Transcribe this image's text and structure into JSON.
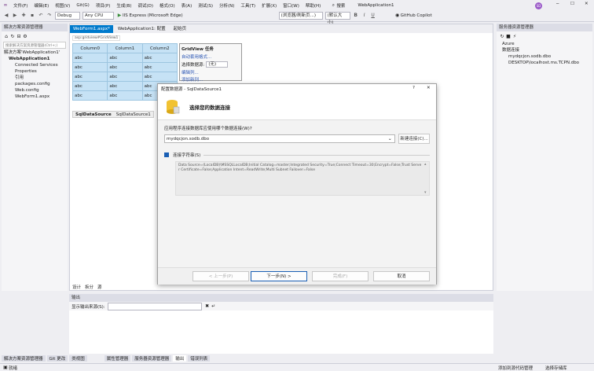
{
  "menu": {
    "items": [
      "文件(F)",
      "编辑(E)",
      "视图(V)",
      "Git(G)",
      "项目(P)",
      "生成(B)",
      "调试(D)",
      "格式(O)",
      "表(A)",
      "测试(S)",
      "分析(N)",
      "工具(T)",
      "扩展(X)",
      "窗口(W)",
      "帮助(H)"
    ],
    "search": "搜索",
    "solution_name": "WebApplication1",
    "avatar": "SD"
  },
  "toolbar": {
    "config": "Debug",
    "platform": "Any CPU",
    "run": "IIS Express (Microsoft Edge)",
    "browser_combo": "(浏览器/刷新页...)",
    "font_size": "(默认大小)",
    "copilot": "GitHub Copilot"
  },
  "solution_explorer": {
    "title": "解决方案资源管理器",
    "search_placeholder": "搜索解决方案资源管理器(Ctrl+;)",
    "items": [
      {
        "label": "解决方案'WebApplication1'",
        "indent": 0
      },
      {
        "label": "WebApplication1",
        "indent": 1
      },
      {
        "label": "Connected Services",
        "indent": 2
      },
      {
        "label": "Properties",
        "indent": 2
      },
      {
        "label": "引用",
        "indent": 2
      },
      {
        "label": "packages.config",
        "indent": 2
      },
      {
        "label": "Web.config",
        "indent": 2
      },
      {
        "label": "WebForm1.aspx",
        "indent": 2
      }
    ]
  },
  "editor": {
    "tabs": [
      "WebForm1.aspx*",
      "WebApplication1: 配置",
      "起始页"
    ],
    "path": "asp:gridview#GridView1",
    "columns": [
      "Column0",
      "Column1",
      "Column2"
    ],
    "rows": [
      [
        "abc",
        "abc",
        "abc"
      ],
      [
        "abc",
        "abc",
        "abc"
      ],
      [
        "abc",
        "abc",
        "abc"
      ],
      [
        "abc",
        "abc",
        "abc"
      ],
      [
        "abc",
        "abc",
        "abc"
      ]
    ],
    "datasource_tabs": [
      "SqlDataSource",
      "SqlDataSource1"
    ],
    "bottom_tabs": [
      "设计",
      "拆分",
      "源"
    ]
  },
  "gridview_tasks": {
    "title": "GridView 任务",
    "autoformat": "自动套用格式...",
    "choose_ds_label": "选择数据源:",
    "choose_ds_value": "(无)",
    "edit_columns": "编辑列...",
    "add_column": "添加新列..."
  },
  "dialog": {
    "title": "配置数据源 - SqlDataSource1",
    "question": "?",
    "close": "✕",
    "heading": "选择您的数据连接",
    "question_label": "应用程序连接数据库应使用哪个数据连接(W)?",
    "connection_value": "mydqcjon.sodb.dbo",
    "new_connection": "新建连接(C)...",
    "conn_string_label": "连接字符串(S)",
    "conn_string": "Data Source=(LocalDB)\\MSSQLLocalDB;Initial Catalog=master;Integrated Security=True;Connect Timeout=30;Encrypt=False;Trust Server Certificate=False;Application Intent=ReadWrite;Multi Subnet Failover=False",
    "buttons": {
      "prev": "< 上一步(P)",
      "next": "下一步(N) >",
      "finish": "完成(F)",
      "cancel": "取消"
    }
  },
  "server_explorer": {
    "title": "服务器资源管理器",
    "items": [
      {
        "label": "Azure",
        "indent": 0
      },
      {
        "label": "数据连接",
        "indent": 0
      },
      {
        "label": "mydqcjon.sodb.dbo",
        "indent": 1
      },
      {
        "label": "DESKTOP\\localhost.ms.TCPN.dbo",
        "indent": 1
      }
    ]
  },
  "output": {
    "title": "输出",
    "show_from": "显示输出来源(S):"
  },
  "bottom_tabs": [
    "解决方案资源管理器",
    "Git 更改",
    "类视图",
    "属性管理器",
    "服务器资源管理器",
    "输出",
    "错误列表"
  ],
  "status": {
    "left": "就绪",
    "add_source": "添加到源代码管理",
    "select_repo": "选择存储库"
  }
}
